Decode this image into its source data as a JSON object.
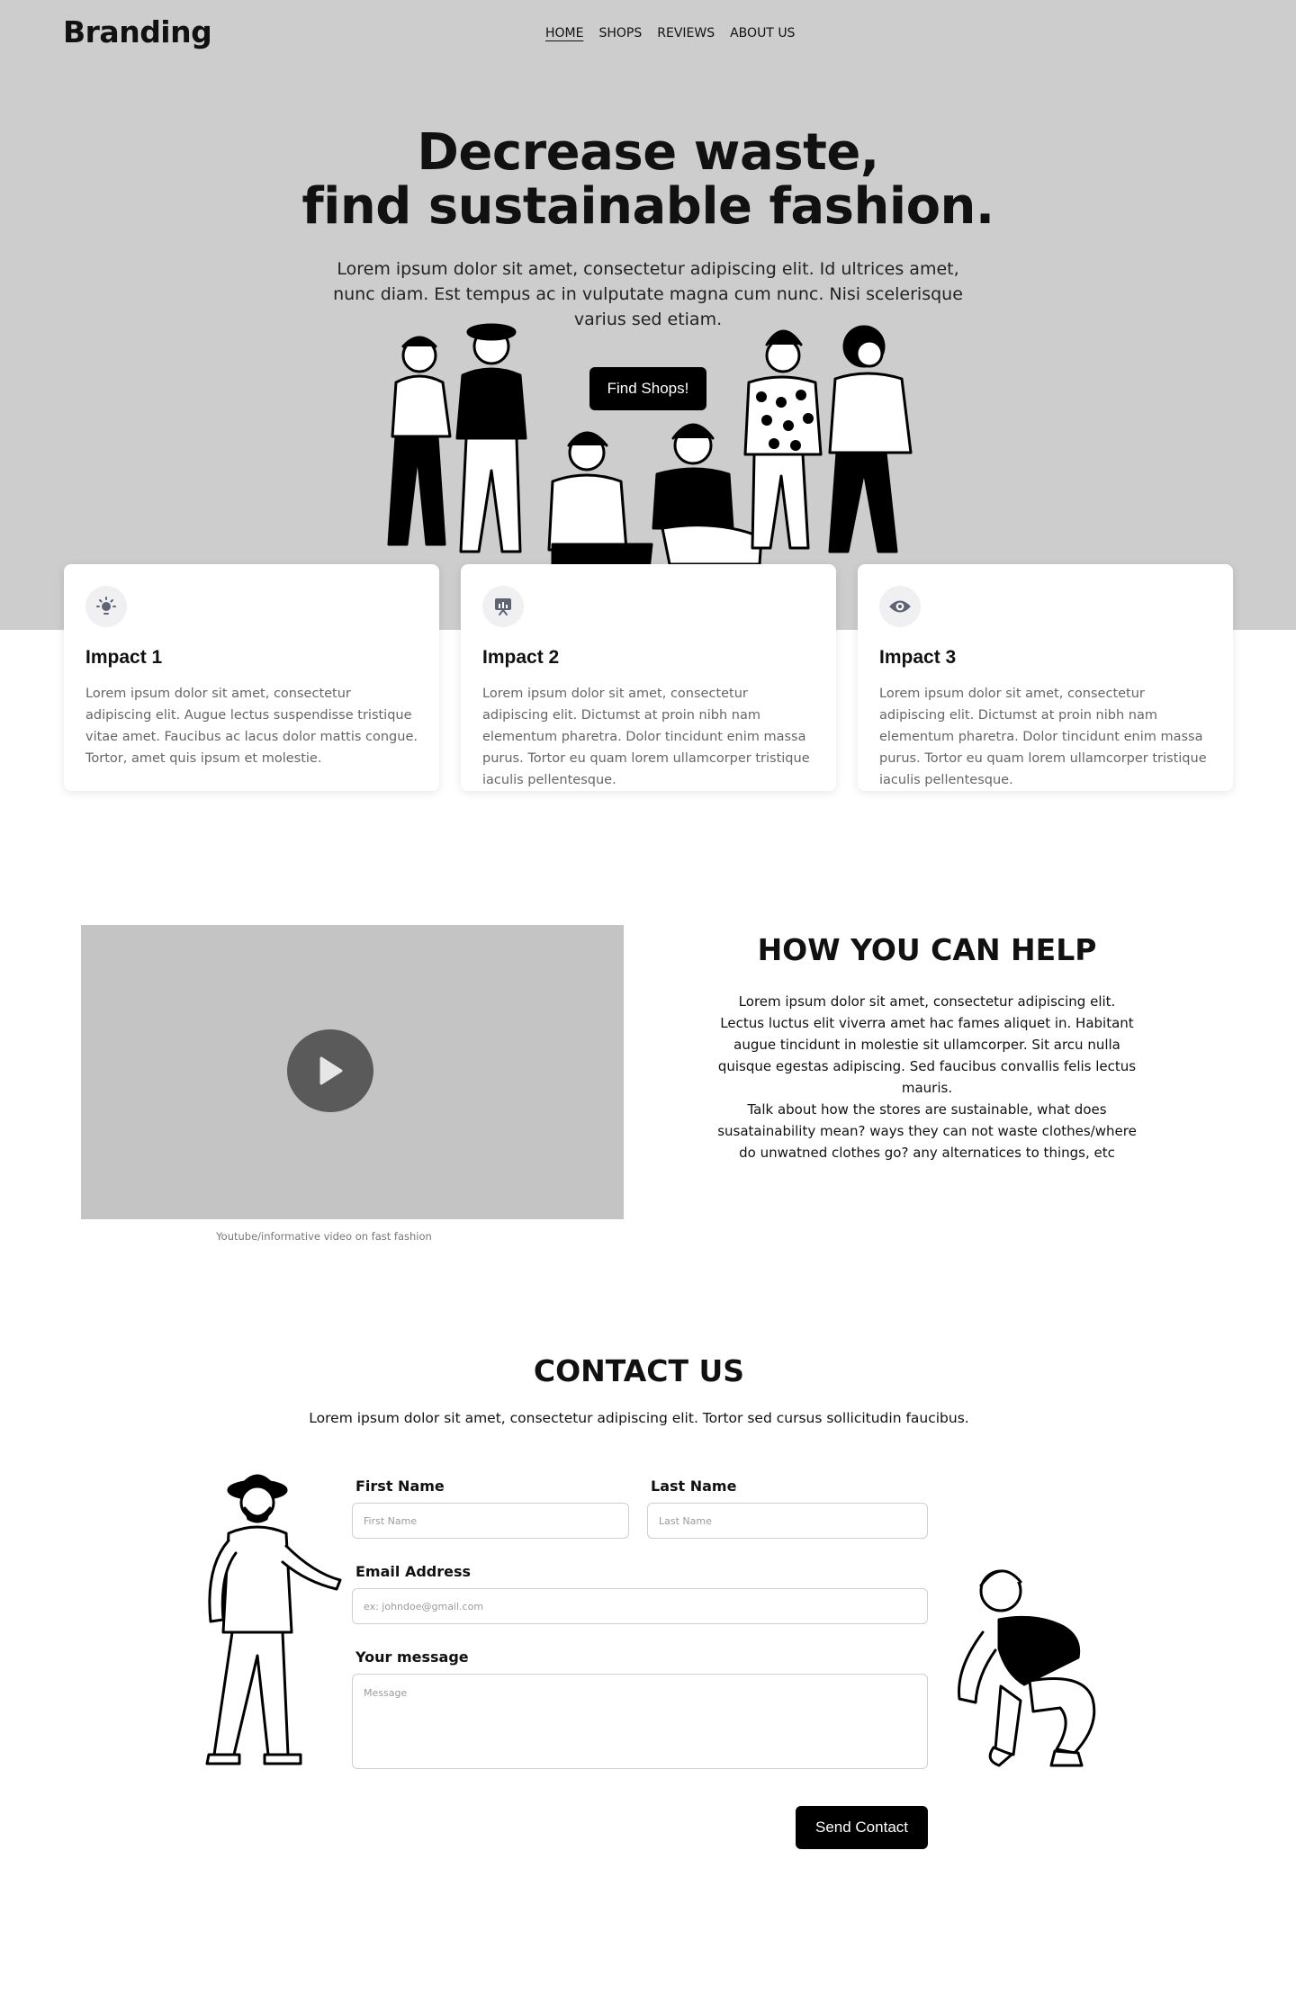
{
  "header": {
    "brand": "Branding",
    "nav": [
      "HOME",
      "SHOPS",
      "REVIEWS",
      "ABOUT US"
    ]
  },
  "hero": {
    "title_line1": "Decrease waste,",
    "title_line2": "find sustainable fashion.",
    "subtitle": "Lorem ipsum dolor sit amet, consectetur adipiscing elit. Id ultrices amet, nunc diam. Est tempus ac in vulputate magna cum nunc. Nisi scelerisque varius sed etiam.",
    "cta_label": "Find Shops!"
  },
  "impacts": [
    {
      "icon": "lightbulb-icon",
      "title": "Impact 1",
      "text": "Lorem ipsum dolor sit amet, consectetur adipiscing elit. Augue lectus suspendisse tristique vitae amet. Faucibus ac lacus dolor mattis congue. Tortor, amet quis ipsum et molestie."
    },
    {
      "icon": "presentation-chart-icon",
      "title": "Impact 2",
      "text": "Lorem ipsum dolor sit amet, consectetur adipiscing elit. Dictumst at proin nibh nam elementum pharetra. Dolor tincidunt enim massa purus. Tortor eu quam lorem ullamcorper tristique iaculis pellentesque."
    },
    {
      "icon": "eye-icon",
      "title": "Impact 3",
      "text": "Lorem ipsum dolor sit amet, consectetur adipiscing elit. Dictumst at proin nibh nam elementum pharetra. Dolor tincidunt enim massa purus. Tortor eu quam lorem ullamcorper tristique iaculis pellentesque."
    }
  ],
  "video": {
    "caption": "Youtube/informative video on fast fashion"
  },
  "help": {
    "title": "HOW YOU CAN HELP",
    "paragraph1": "Lorem ipsum dolor sit amet, consectetur adipiscing elit. Lectus luctus elit viverra amet hac fames aliquet in. Habitant augue tincidunt in molestie sit ullamcorper. Sit arcu nulla quisque egestas adipiscing. Sed faucibus convallis felis lectus mauris.",
    "paragraph2": "Talk about how the stores are sustainable, what does susatainability mean? ways they can not waste clothes/where do unwatned clothes go? any alternatices to things, etc"
  },
  "contact": {
    "title": "CONTACT US",
    "subtitle": "Lorem ipsum dolor sit amet, consectetur adipiscing elit. Tortor sed cursus sollicitudin faucibus.",
    "first_name_label": "First Name",
    "first_name_placeholder": "First Name",
    "last_name_label": "Last Name",
    "last_name_placeholder": "Last Name",
    "email_label": "Email Address",
    "email_placeholder": "ex: johndoe@gmail.com",
    "message_label": "Your message",
    "message_placeholder": "Message",
    "send_label": "Send Contact"
  },
  "colors": {
    "hero_bg": "#cdcdcd",
    "button": "#000000",
    "video_bg": "#c4c4c4",
    "icon": "#5e6474"
  }
}
